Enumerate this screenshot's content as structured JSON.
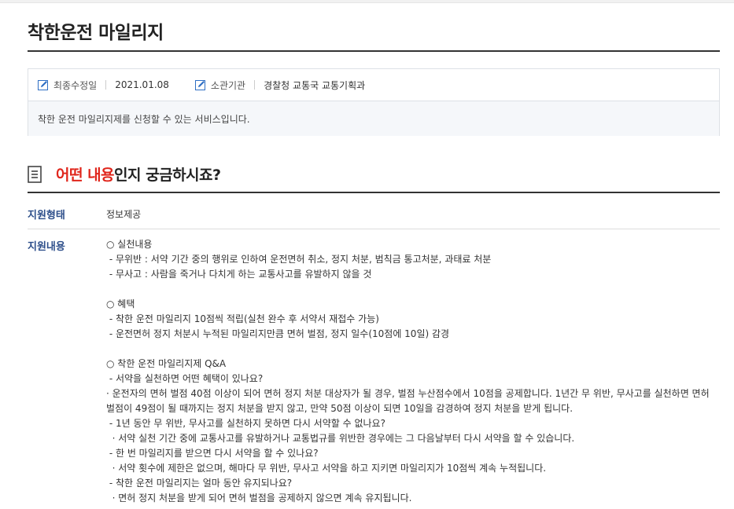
{
  "page_title": "착한운전 마일리지",
  "meta": {
    "modified_label": "최종수정일",
    "modified_value": "2021.01.08",
    "agency_label": "소관기관",
    "agency_value": "경찰청 교통국 교통기획과",
    "description": "착한 운전 마일리지제를 신청할 수 있는 서비스입니다."
  },
  "section": {
    "title_highlight": "어떤 내용",
    "title_rest": "인지 궁금하시죠?"
  },
  "support_type": {
    "label": "지원형태",
    "value": "정보제공"
  },
  "support_content": {
    "label": "지원내용",
    "lines": [
      "○ 실천내용",
      " - 무위반 : 서약 기간 중의 행위로 인하여 운전면허 취소, 정지 처분, 범칙금 통고처분, 과태료 처분",
      " - 무사고 : 사람을 죽거나 다치게 하는 교통사고를 유발하지 않을 것",
      "",
      "○ 혜택",
      " - 착한 운전 마일리지 10점씩 적립(실천 완수 후 서약서 재접수 가능)",
      " - 운전면허 정지 처분시 누적된 마일리지만큼 면허 벌점, 정지 일수(10점에 10일) 감경",
      "",
      "○ 착한 운전 마일리지제 Q&A",
      " - 서약을 실천하면 어떤 혜택이 있나요?",
      "  · 운전자의 면허 벌점 40점 이상이 되어 면허 정지 처분 대상자가 될 경우, 벌점 누산점수에서 10점을 공제합니다. 1년간 무 위반, 무사고를 실천하면 면허 벌점이 49점이 될 때까지는 정지 처분을 받지 않고, 만약 50점 이상이 되면 10일을 감경하여 정지 처분을 받게 됩니다.",
      " - 1년 동안 무 위반, 무사고를 실천하지 못하면 다시 서약할 수 없나요?",
      "  · 서약 실천 기간 중에 교통사고를 유발하거나 교통법규를 위반한 경우에는 그 다음날부터 다시 서약을 할 수 있습니다.",
      " - 한 번 마일리지를 받으면 다시 서약을 할 수 있나요?",
      "  · 서약 횟수에 제한은 없으며, 해마다 무 위반, 무사고 서약을 하고 지키면 마일리지가 10점씩 계속 누적됩니다.",
      " - 착한 운전 마일리지는 얼마 동안 유지되나요?",
      "  · 면허 정지 처분을 받게 되어 면허 벌점을 공제하지 않으면 계속 유지됩니다."
    ]
  }
}
